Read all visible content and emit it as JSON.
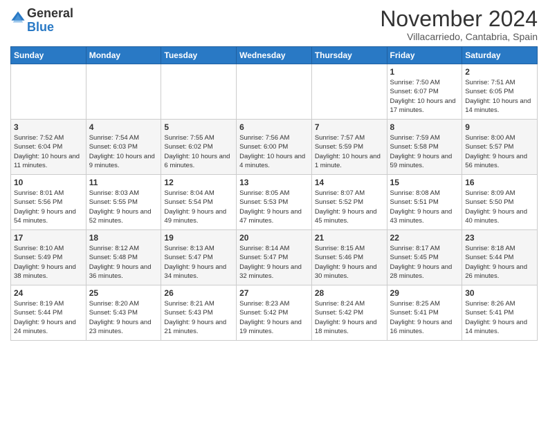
{
  "logo": {
    "general": "General",
    "blue": "Blue"
  },
  "title": "November 2024",
  "location": "Villacarriedo, Cantabria, Spain",
  "days_of_week": [
    "Sunday",
    "Monday",
    "Tuesday",
    "Wednesday",
    "Thursday",
    "Friday",
    "Saturday"
  ],
  "weeks": [
    [
      {
        "day": "",
        "info": ""
      },
      {
        "day": "",
        "info": ""
      },
      {
        "day": "",
        "info": ""
      },
      {
        "day": "",
        "info": ""
      },
      {
        "day": "",
        "info": ""
      },
      {
        "day": "1",
        "info": "Sunrise: 7:50 AM\nSunset: 6:07 PM\nDaylight: 10 hours and 17 minutes."
      },
      {
        "day": "2",
        "info": "Sunrise: 7:51 AM\nSunset: 6:05 PM\nDaylight: 10 hours and 14 minutes."
      }
    ],
    [
      {
        "day": "3",
        "info": "Sunrise: 7:52 AM\nSunset: 6:04 PM\nDaylight: 10 hours and 11 minutes."
      },
      {
        "day": "4",
        "info": "Sunrise: 7:54 AM\nSunset: 6:03 PM\nDaylight: 10 hours and 9 minutes."
      },
      {
        "day": "5",
        "info": "Sunrise: 7:55 AM\nSunset: 6:02 PM\nDaylight: 10 hours and 6 minutes."
      },
      {
        "day": "6",
        "info": "Sunrise: 7:56 AM\nSunset: 6:00 PM\nDaylight: 10 hours and 4 minutes."
      },
      {
        "day": "7",
        "info": "Sunrise: 7:57 AM\nSunset: 5:59 PM\nDaylight: 10 hours and 1 minute."
      },
      {
        "day": "8",
        "info": "Sunrise: 7:59 AM\nSunset: 5:58 PM\nDaylight: 9 hours and 59 minutes."
      },
      {
        "day": "9",
        "info": "Sunrise: 8:00 AM\nSunset: 5:57 PM\nDaylight: 9 hours and 56 minutes."
      }
    ],
    [
      {
        "day": "10",
        "info": "Sunrise: 8:01 AM\nSunset: 5:56 PM\nDaylight: 9 hours and 54 minutes."
      },
      {
        "day": "11",
        "info": "Sunrise: 8:03 AM\nSunset: 5:55 PM\nDaylight: 9 hours and 52 minutes."
      },
      {
        "day": "12",
        "info": "Sunrise: 8:04 AM\nSunset: 5:54 PM\nDaylight: 9 hours and 49 minutes."
      },
      {
        "day": "13",
        "info": "Sunrise: 8:05 AM\nSunset: 5:53 PM\nDaylight: 9 hours and 47 minutes."
      },
      {
        "day": "14",
        "info": "Sunrise: 8:07 AM\nSunset: 5:52 PM\nDaylight: 9 hours and 45 minutes."
      },
      {
        "day": "15",
        "info": "Sunrise: 8:08 AM\nSunset: 5:51 PM\nDaylight: 9 hours and 43 minutes."
      },
      {
        "day": "16",
        "info": "Sunrise: 8:09 AM\nSunset: 5:50 PM\nDaylight: 9 hours and 40 minutes."
      }
    ],
    [
      {
        "day": "17",
        "info": "Sunrise: 8:10 AM\nSunset: 5:49 PM\nDaylight: 9 hours and 38 minutes."
      },
      {
        "day": "18",
        "info": "Sunrise: 8:12 AM\nSunset: 5:48 PM\nDaylight: 9 hours and 36 minutes."
      },
      {
        "day": "19",
        "info": "Sunrise: 8:13 AM\nSunset: 5:47 PM\nDaylight: 9 hours and 34 minutes."
      },
      {
        "day": "20",
        "info": "Sunrise: 8:14 AM\nSunset: 5:47 PM\nDaylight: 9 hours and 32 minutes."
      },
      {
        "day": "21",
        "info": "Sunrise: 8:15 AM\nSunset: 5:46 PM\nDaylight: 9 hours and 30 minutes."
      },
      {
        "day": "22",
        "info": "Sunrise: 8:17 AM\nSunset: 5:45 PM\nDaylight: 9 hours and 28 minutes."
      },
      {
        "day": "23",
        "info": "Sunrise: 8:18 AM\nSunset: 5:44 PM\nDaylight: 9 hours and 26 minutes."
      }
    ],
    [
      {
        "day": "24",
        "info": "Sunrise: 8:19 AM\nSunset: 5:44 PM\nDaylight: 9 hours and 24 minutes."
      },
      {
        "day": "25",
        "info": "Sunrise: 8:20 AM\nSunset: 5:43 PM\nDaylight: 9 hours and 23 minutes."
      },
      {
        "day": "26",
        "info": "Sunrise: 8:21 AM\nSunset: 5:43 PM\nDaylight: 9 hours and 21 minutes."
      },
      {
        "day": "27",
        "info": "Sunrise: 8:23 AM\nSunset: 5:42 PM\nDaylight: 9 hours and 19 minutes."
      },
      {
        "day": "28",
        "info": "Sunrise: 8:24 AM\nSunset: 5:42 PM\nDaylight: 9 hours and 18 minutes."
      },
      {
        "day": "29",
        "info": "Sunrise: 8:25 AM\nSunset: 5:41 PM\nDaylight: 9 hours and 16 minutes."
      },
      {
        "day": "30",
        "info": "Sunrise: 8:26 AM\nSunset: 5:41 PM\nDaylight: 9 hours and 14 minutes."
      }
    ]
  ]
}
